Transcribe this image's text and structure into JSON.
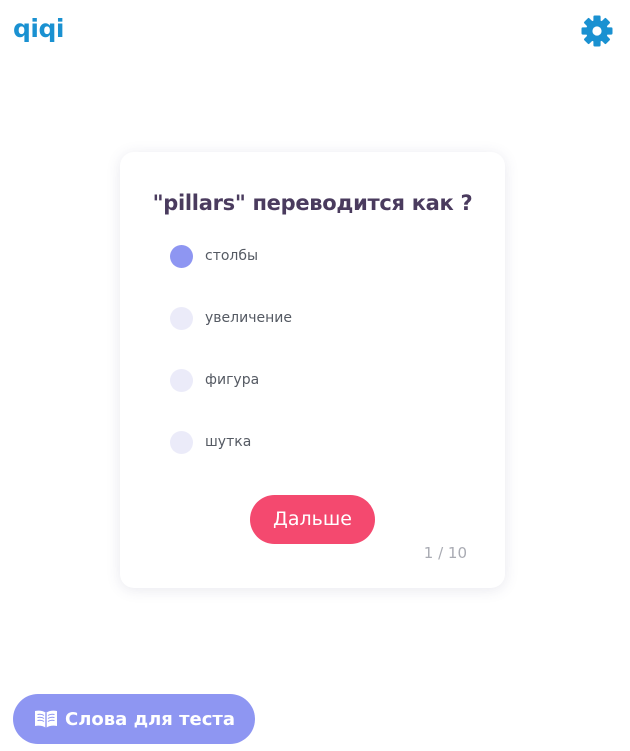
{
  "header": {
    "logo": "qiqi",
    "settings_icon": "gear-icon"
  },
  "quiz": {
    "question": "\"pillars\" переводится как ?",
    "options": [
      {
        "label": "столбы",
        "selected": true
      },
      {
        "label": "увеличение",
        "selected": false
      },
      {
        "label": "фигура",
        "selected": false
      },
      {
        "label": "шутка",
        "selected": false
      }
    ],
    "next_label": "Дальше",
    "counter": "1 / 10"
  },
  "footer": {
    "words_button_label": "Слова для теста",
    "words_button_icon": "book-icon"
  },
  "colors": {
    "logo": "#1a91d1",
    "question_text": "#4a3b5e",
    "radio_selected": "#8e96f2",
    "radio_unselected": "#ebebf9",
    "next_button": "#f4496f",
    "words_button": "#8e96f2"
  }
}
